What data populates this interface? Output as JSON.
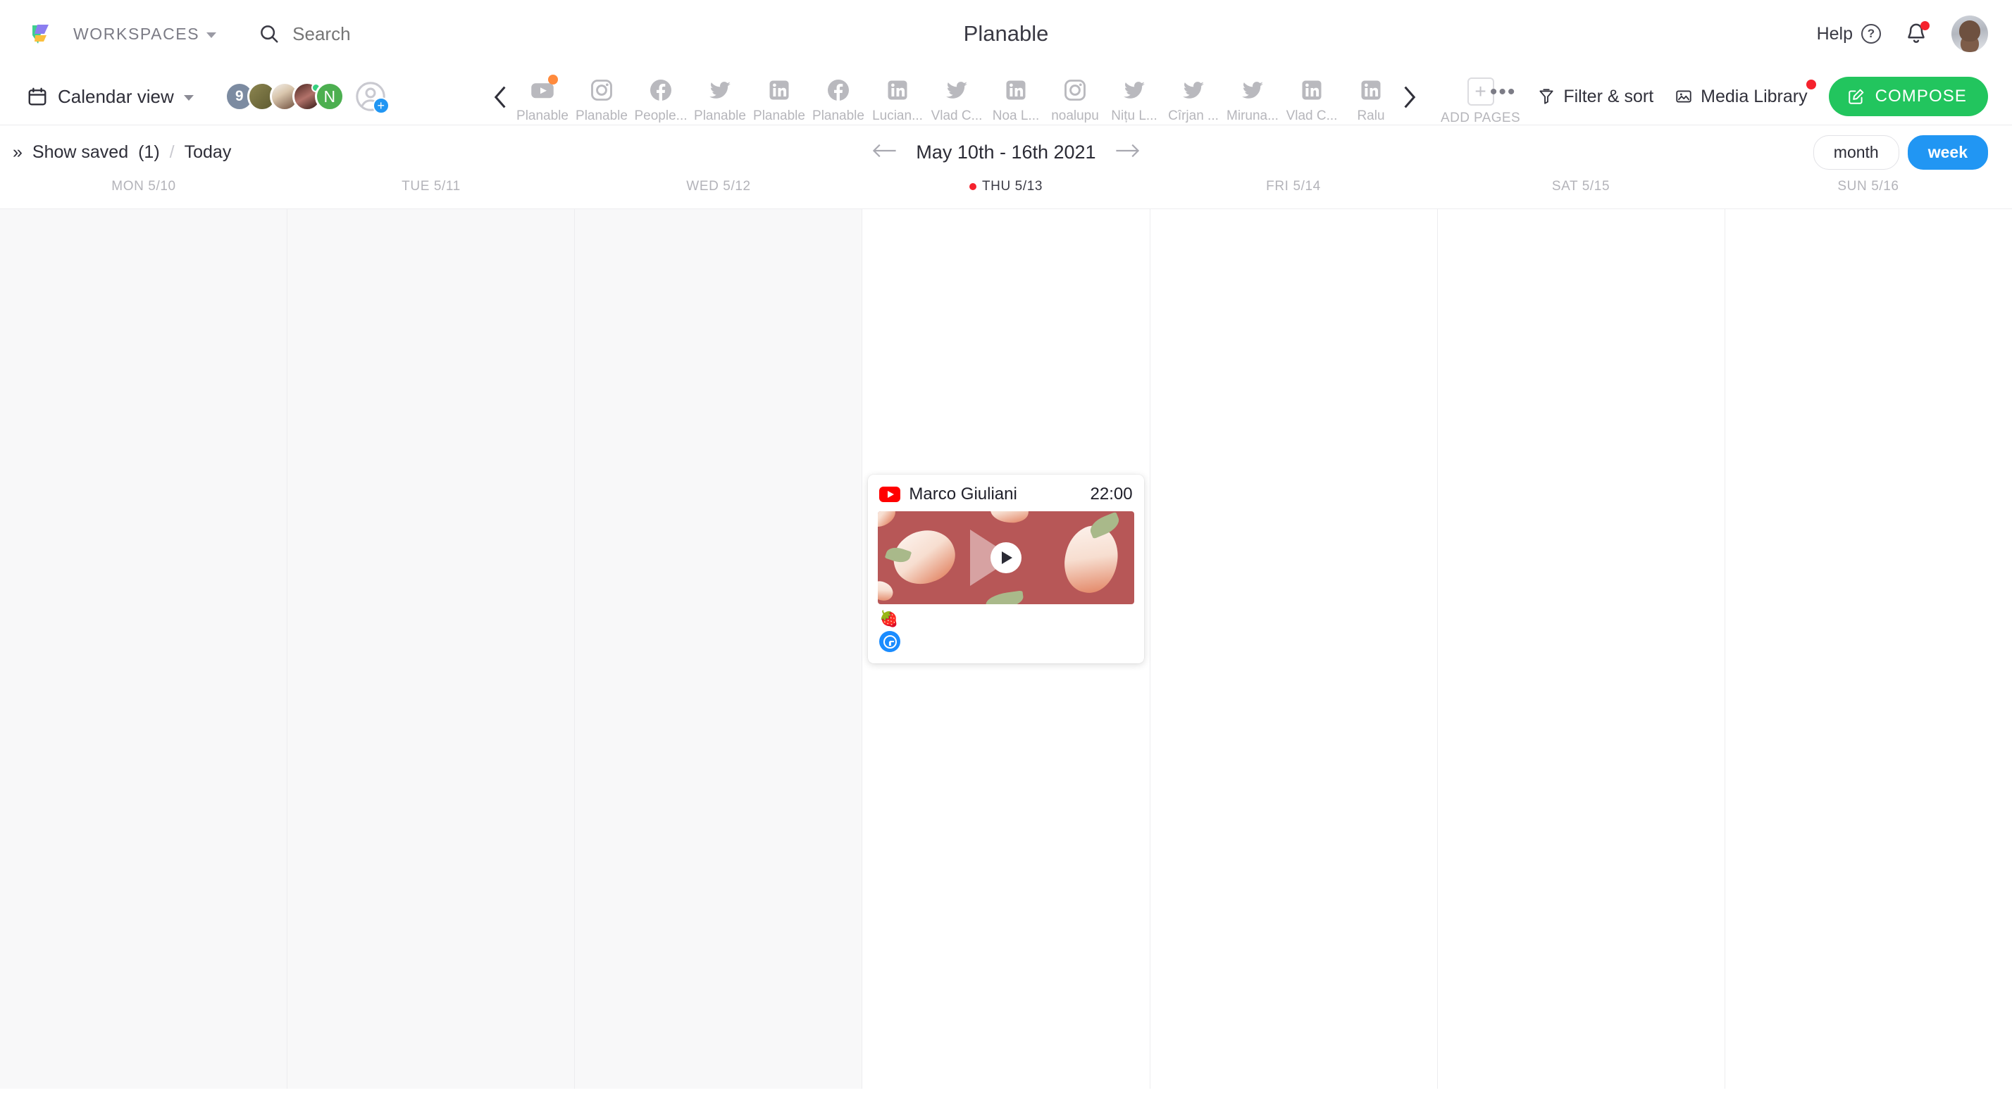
{
  "header": {
    "logo_icon": "planable-logo-icon",
    "workspaces_label": "WORKSPACES",
    "search_icon": "search-icon",
    "search_placeholder": "Search",
    "search_value": "",
    "app_title": "Planable",
    "help_label": "Help",
    "help_icon": "question-circle-icon",
    "notifications_icon": "bell-icon",
    "notifications_has_badge": true,
    "avatar": "user-avatar"
  },
  "subbar": {
    "view_selector_label": "Calendar view",
    "calendar_icon": "calendar-icon",
    "avatars": [
      {
        "type": "count",
        "label": "9"
      },
      {
        "type": "photo",
        "label": ""
      },
      {
        "type": "photo",
        "label": ""
      },
      {
        "type": "photo",
        "label": "",
        "online": true
      },
      {
        "type": "letter",
        "label": "N"
      }
    ],
    "add_member_icon": "add-user-icon"
  },
  "pages": {
    "scroll_left_icon": "chevron-left-icon",
    "scroll_right_icon": "chevron-right-icon",
    "items": [
      {
        "label": "Planable",
        "network": "youtube",
        "badge": true
      },
      {
        "label": "Planable",
        "network": "instagram",
        "badge": false
      },
      {
        "label": "People...",
        "network": "facebook",
        "badge": false
      },
      {
        "label": "Planable",
        "network": "twitter",
        "badge": false
      },
      {
        "label": "Planable",
        "network": "linkedin",
        "badge": false
      },
      {
        "label": "Planable",
        "network": "facebook",
        "badge": false
      },
      {
        "label": "Lucian...",
        "network": "linkedin",
        "badge": false
      },
      {
        "label": "Vlad C...",
        "network": "twitter",
        "badge": false
      },
      {
        "label": "Noa L...",
        "network": "linkedin",
        "badge": false
      },
      {
        "label": "noalupu",
        "network": "instagram",
        "badge": false
      },
      {
        "label": "Nițu L...",
        "network": "twitter",
        "badge": false
      },
      {
        "label": "Cîrjan ...",
        "network": "twitter",
        "badge": false
      },
      {
        "label": "Miruna...",
        "network": "twitter",
        "badge": false
      },
      {
        "label": "Vlad C...",
        "network": "linkedin",
        "badge": false
      },
      {
        "label": "Ralu",
        "network": "linkedin",
        "badge": false
      }
    ],
    "add_pages_label": "ADD PAGES",
    "add_pages_icon": "plus-box-icon"
  },
  "toolbar": {
    "more_icon": "ellipsis-icon",
    "filter_label": "Filter & sort",
    "filter_icon": "filter-icon",
    "media_library_label": "Media Library",
    "media_library_icon": "image-icon",
    "media_library_has_badge": true,
    "compose_label": "COMPOSE",
    "compose_icon": "compose-pencil-icon",
    "compose_color": "#22c55e"
  },
  "datebar": {
    "expand_icon": "double-chevron-right-icon",
    "show_saved_label": "Show saved",
    "show_saved_count": "(1)",
    "separator": "/",
    "today_label": "Today",
    "prev_icon": "arrow-left-icon",
    "next_icon": "arrow-right-icon",
    "range_label": "May 10th - 16th 2021",
    "view_month_label": "month",
    "view_week_label": "week",
    "active_view": "week",
    "active_color": "#2196f3"
  },
  "calendar": {
    "days": [
      {
        "label": "MON 5/10",
        "today": false,
        "past": true
      },
      {
        "label": "TUE 5/11",
        "today": false,
        "past": true
      },
      {
        "label": "WED 5/12",
        "today": false,
        "past": true
      },
      {
        "label": "THU 5/13",
        "today": true,
        "past": false
      },
      {
        "label": "FRI 5/14",
        "today": false,
        "past": false
      },
      {
        "label": "SAT 5/15",
        "today": false,
        "past": false
      },
      {
        "label": "SUN 5/16",
        "today": false,
        "past": false
      }
    ],
    "posts": [
      {
        "day_index": 3,
        "network": "youtube",
        "network_color": "#ff0000",
        "author": "Marco Giuliani",
        "time": "22:00",
        "caption": "🍓",
        "media_type": "video",
        "media_description": "strawberries on red background",
        "status_icon": "clock-badge-icon",
        "status_color": "#1a8cff"
      }
    ]
  }
}
